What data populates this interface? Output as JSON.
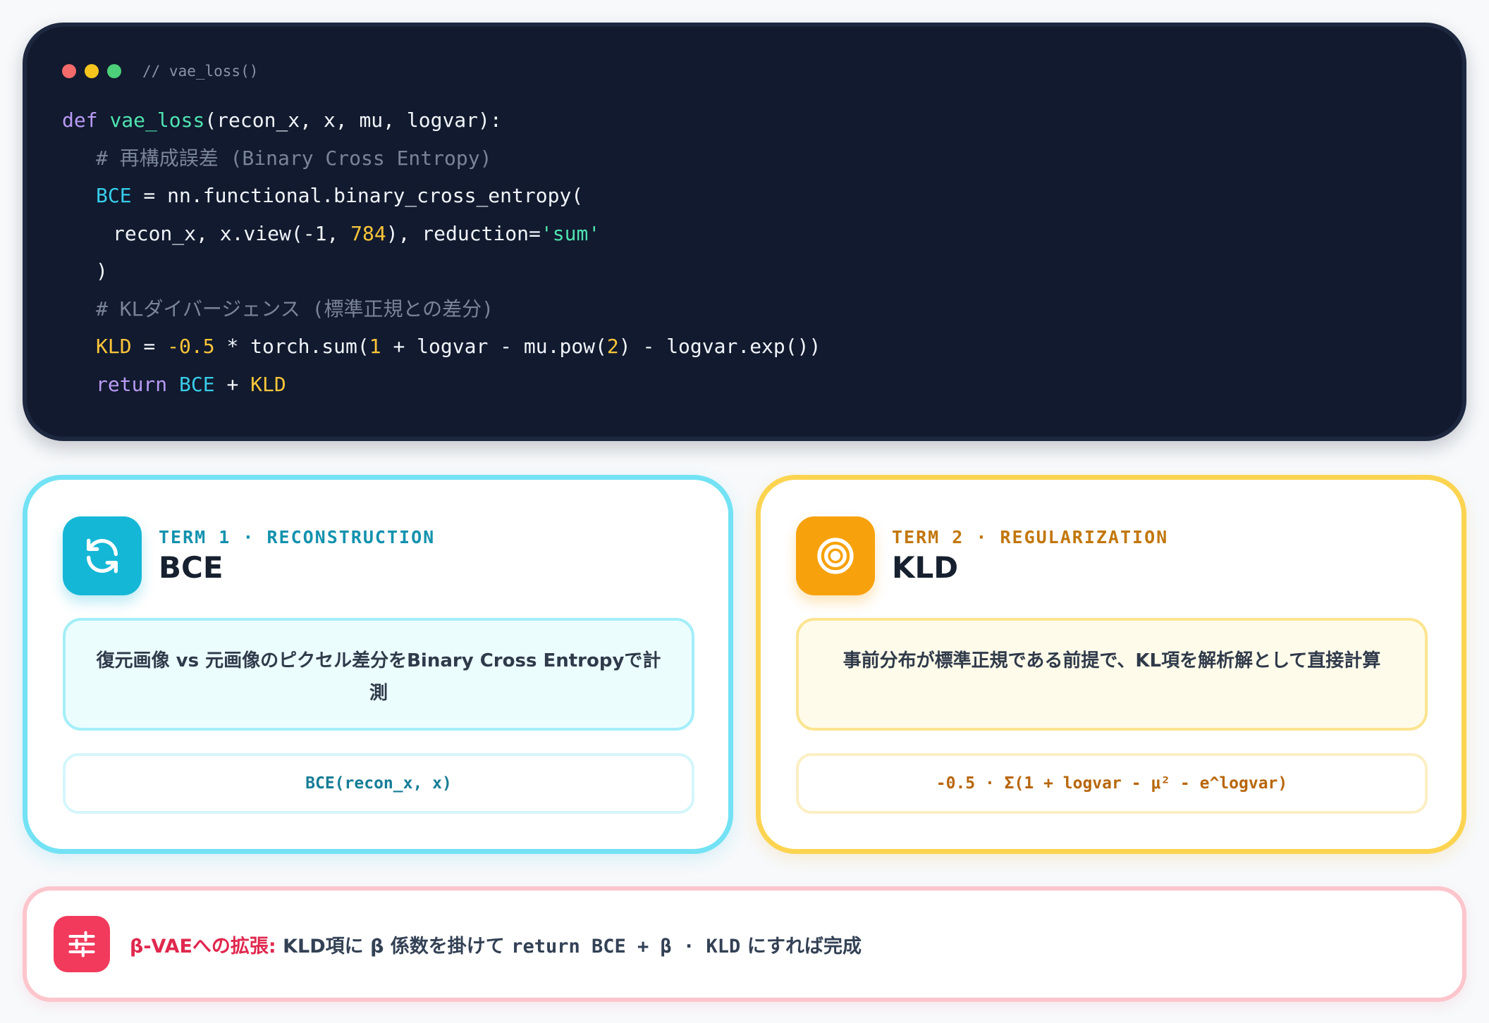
{
  "window": {
    "title": "// vae_loss()"
  },
  "code": {
    "l1": {
      "kw": "def",
      "fn": "vae_loss",
      "rest": "(recon_x, x, mu, logvar):"
    },
    "l2": "# 再構成誤差 (Binary Cross Entropy)",
    "l3": {
      "var": "BCE",
      "rest": " = nn.functional.binary_cross_entropy("
    },
    "l4": {
      "a": "recon_x, x.view(-1, ",
      "num": "784",
      "b": "), reduction=",
      "str": "'sum'"
    },
    "l5": ")",
    "l6": "# KLダイバージェンス (標準正規との差分)",
    "l7": {
      "var": "KLD",
      "eq": " = ",
      "num1": "-0.5",
      "a": " * torch.sum(",
      "num2": "1",
      "b": " + logvar - mu.pow(",
      "num3": "2",
      "c": ") - logvar.exp())"
    },
    "l8": {
      "kw": "return",
      "v1": "BCE",
      "plus": " + ",
      "v2": "KLD"
    }
  },
  "cards": {
    "bce": {
      "label": "TERM 1 · RECONSTRUCTION",
      "name": "BCE",
      "icon": "refresh-icon",
      "desc": "復元画像 vs 元画像のピクセル差分をBinary Cross Entropyで計測",
      "formula": "BCE(recon_x, x)",
      "color": "#15b7d6"
    },
    "kld": {
      "label": "TERM 2 · REGULARIZATION",
      "name": "KLD",
      "icon": "target-icon",
      "desc": "事前分布が標準正規である前提で、KL項を解析解として直接計算",
      "formula": "-0.5 · Σ(1 + logvar - μ² - e^logvar)",
      "color": "#f7a20c"
    }
  },
  "note": {
    "icon": "sliders-icon",
    "lead": "β-VAEへの拡張:",
    "text1": " KLD項に β 係数を掛けて ",
    "code": "return BCE + β · KLD",
    "text2": " にすれば完成",
    "color": "#f23a5c"
  }
}
